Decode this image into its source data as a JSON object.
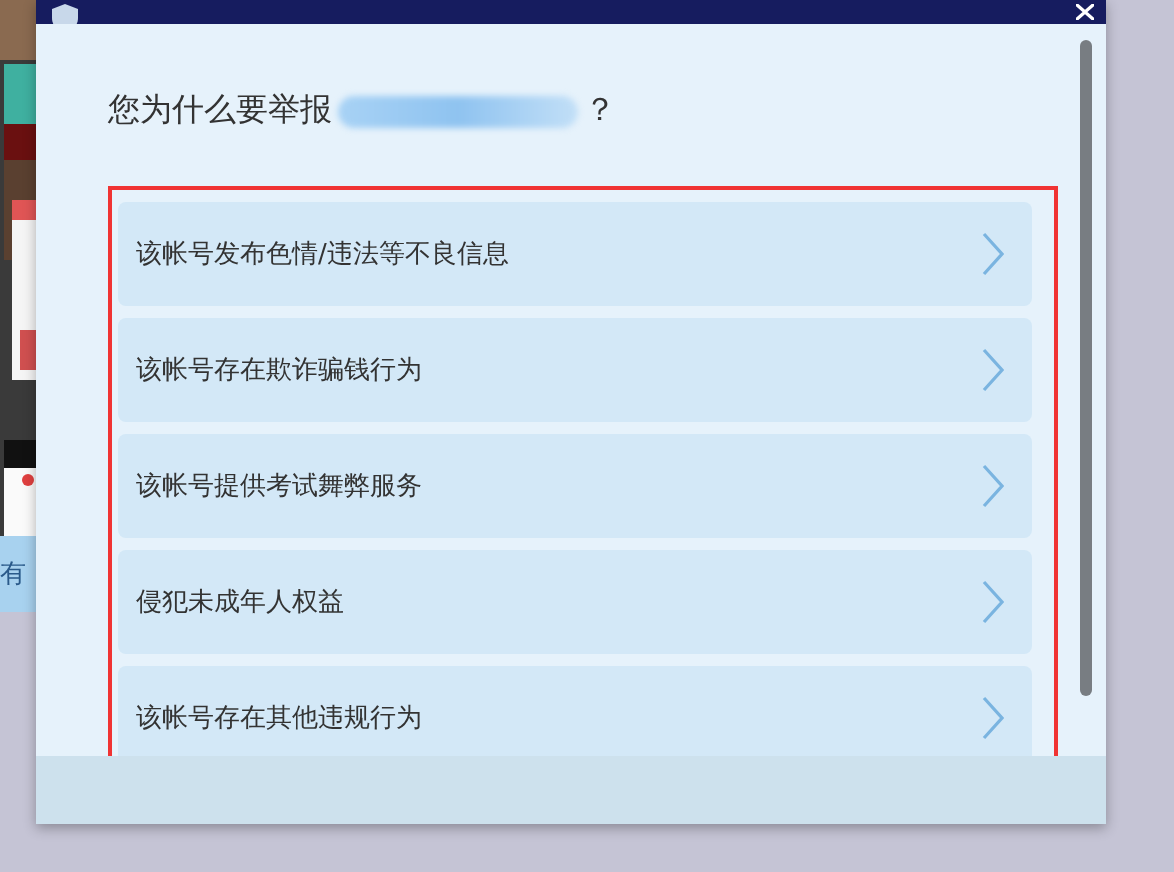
{
  "background": {
    "side_text": "有"
  },
  "dialog": {
    "question": {
      "prefix": "您为什么要举报",
      "redacted": true,
      "suffix": "？"
    },
    "options": [
      {
        "label": "该帐号发布色情/违法等不良信息"
      },
      {
        "label": "该帐号存在欺诈骗钱行为"
      },
      {
        "label": "该帐号提供考试舞弊服务"
      },
      {
        "label": "侵犯未成年人权益"
      },
      {
        "label": "该帐号存在其他违规行为"
      }
    ],
    "highlighted": true
  }
}
